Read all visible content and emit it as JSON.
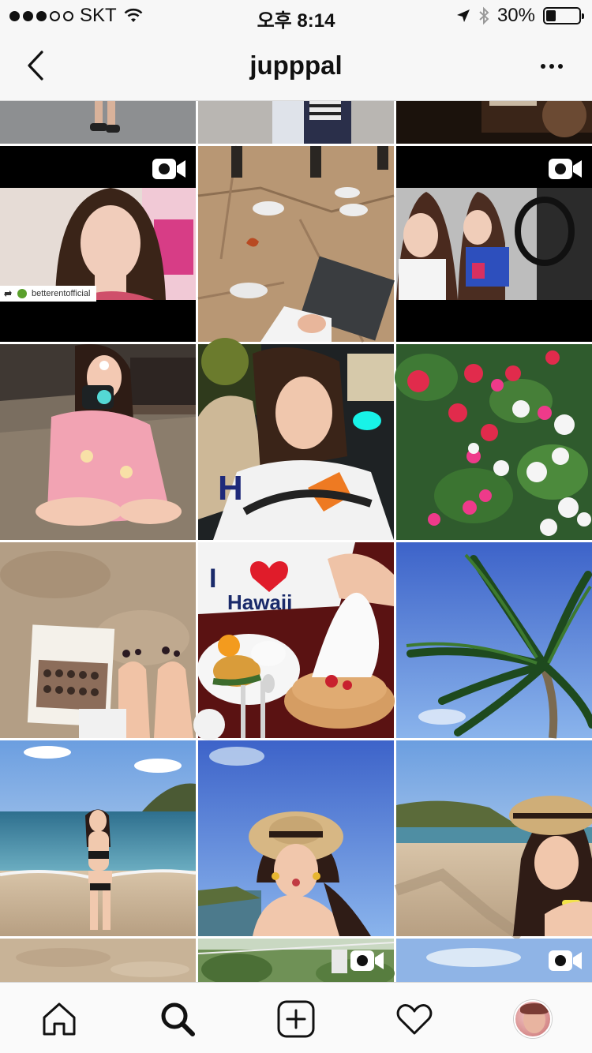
{
  "status_bar": {
    "carrier": "SKT",
    "signal_bars_filled": 3,
    "signal_bars_total": 5,
    "time": "오후 8:14",
    "battery_percent_text": "30%",
    "battery_level": 0.3
  },
  "nav": {
    "title": "jupppal",
    "back_icon": "chevron-left-icon",
    "more_icon": "more-horizontal-icon"
  },
  "grid": {
    "columns": 3,
    "repost_credit": "betterentofficial",
    "video_badge_icon": "video-camera-icon",
    "posts": [
      {
        "row": 0,
        "col": 0,
        "subject": "feet-on-pavement",
        "video": false
      },
      {
        "row": 0,
        "col": 1,
        "subject": "street-outfit",
        "video": false
      },
      {
        "row": 0,
        "col": 2,
        "subject": "dessert-dark",
        "video": false
      },
      {
        "row": 1,
        "col": 0,
        "subject": "repost-portrait",
        "video": true
      },
      {
        "row": 1,
        "col": 1,
        "subject": "seagulls-on-stone",
        "video": false
      },
      {
        "row": 1,
        "col": 2,
        "subject": "car-selfie",
        "video": true
      },
      {
        "row": 2,
        "col": 0,
        "subject": "girl-with-camera",
        "video": false
      },
      {
        "row": 2,
        "col": 1,
        "subject": "night-selfie",
        "video": false
      },
      {
        "row": 2,
        "col": 2,
        "subject": "flowers",
        "video": false
      },
      {
        "row": 3,
        "col": 0,
        "subject": "book-on-sand",
        "video": false
      },
      {
        "row": 3,
        "col": 1,
        "subject": "i-love-hawaii-pancakes",
        "video": false
      },
      {
        "row": 3,
        "col": 2,
        "subject": "palm-tree-sky",
        "video": false
      },
      {
        "row": 4,
        "col": 0,
        "subject": "beach-bikini",
        "video": false
      },
      {
        "row": 4,
        "col": 1,
        "subject": "straw-hat-pout",
        "video": false
      },
      {
        "row": 4,
        "col": 2,
        "subject": "straw-hat-beach",
        "video": false
      },
      {
        "row": 5,
        "col": 0,
        "subject": "sand",
        "video": false
      },
      {
        "row": 5,
        "col": 1,
        "subject": "trees-zipline",
        "video": true
      },
      {
        "row": 5,
        "col": 2,
        "subject": "sky",
        "video": true
      }
    ]
  },
  "shirt_text": {
    "line1": "I",
    "line2": "Hawaii"
  },
  "tab_bar": {
    "items": [
      {
        "name": "home",
        "icon": "home-icon"
      },
      {
        "name": "search",
        "icon": "search-icon",
        "active": true
      },
      {
        "name": "add",
        "icon": "add-post-icon"
      },
      {
        "name": "activity",
        "icon": "heart-icon"
      },
      {
        "name": "profile",
        "icon": "avatar"
      }
    ]
  },
  "colors": {
    "bar_bg": "#f7f7f7",
    "tab_bg": "#fafafa",
    "text": "#111111",
    "divider": "#d8d8d8"
  }
}
